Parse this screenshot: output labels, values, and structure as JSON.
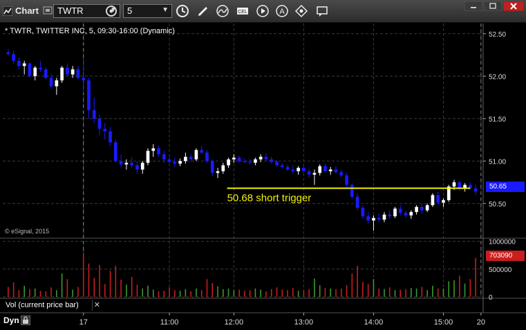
{
  "window": {
    "title": "Chart",
    "symbol_value": "TWTR",
    "interval_value": "5",
    "toolbar_icons": [
      "settings-icon",
      "clock-icon",
      "pencil-icon",
      "curve-icon",
      "study-icon",
      "play-icon",
      "text-icon",
      "tools-icon",
      "message-icon"
    ]
  },
  "chart": {
    "legend": "* TWTR, TWITTER INC, 5, 09:30-16:00 (Dynamic)",
    "copyright": "© eSignal, 2015",
    "last_price_label": "50.65",
    "last_volume_label": "703090",
    "annotation": "50.68 short trigger",
    "indicator_label": "Vol (current price bar)",
    "mode_label": "Dyn",
    "colors": {
      "up": "#ffffff",
      "down": "#1a1aff",
      "vol_up": "#3c9a2c",
      "vol_down": "#c81e1e",
      "trigger_line": "#f2f200",
      "price_tag": "#1a1aff",
      "vol_tag": "#c81e1e"
    }
  },
  "chart_data": {
    "type": "candlestick",
    "symbol": "TWTR",
    "price_axis": {
      "ticks": [
        "52.50",
        "52.00",
        "51.50",
        "51.00",
        "50.50"
      ],
      "ylim": [
        50.1,
        52.62
      ]
    },
    "volume_axis": {
      "ticks": [
        "1000000",
        "500000",
        "0"
      ],
      "ylim": [
        0,
        1020000
      ]
    },
    "time_axis": {
      "labels": [
        "17",
        "11:00",
        "12:00",
        "13:00",
        "14:00",
        "15:00",
        "20"
      ]
    },
    "trigger_level": 50.68,
    "ohlc": [
      [
        52.28,
        52.32,
        52.24,
        52.26
      ],
      [
        52.26,
        52.3,
        52.15,
        52.18
      ],
      [
        52.18,
        52.22,
        52.08,
        52.12
      ],
      [
        52.12,
        52.18,
        52.02,
        52.15
      ],
      [
        52.15,
        52.16,
        51.98,
        52.0
      ],
      [
        52.0,
        52.12,
        51.95,
        52.1
      ],
      [
        52.1,
        52.18,
        52.05,
        52.08
      ],
      [
        52.08,
        52.1,
        51.96,
        51.98
      ],
      [
        51.98,
        52.02,
        51.85,
        51.88
      ],
      [
        51.88,
        51.98,
        51.78,
        51.95
      ],
      [
        51.95,
        52.12,
        51.92,
        52.1
      ],
      [
        52.1,
        52.15,
        52.0,
        52.02
      ],
      [
        52.02,
        52.12,
        51.98,
        52.08
      ],
      [
        52.08,
        52.12,
        51.96,
        51.98
      ],
      [
        51.98,
        52.2,
        51.8,
        51.95
      ],
      [
        51.95,
        51.98,
        51.5,
        51.6
      ],
      [
        51.6,
        51.75,
        51.45,
        51.5
      ],
      [
        51.5,
        51.55,
        51.3,
        51.38
      ],
      [
        51.38,
        51.45,
        51.25,
        51.35
      ],
      [
        51.35,
        51.4,
        51.18,
        51.22
      ],
      [
        51.22,
        51.25,
        50.98,
        51.0
      ],
      [
        51.0,
        51.08,
        50.93,
        50.96
      ],
      [
        50.96,
        51.02,
        50.9,
        50.98
      ],
      [
        50.98,
        51.05,
        50.92,
        50.95
      ],
      [
        50.95,
        51.0,
        50.85,
        50.9
      ],
      [
        50.9,
        51.0,
        50.85,
        50.98
      ],
      [
        50.98,
        51.15,
        50.95,
        51.12
      ],
      [
        51.12,
        51.2,
        51.05,
        51.15
      ],
      [
        51.15,
        51.18,
        51.05,
        51.08
      ],
      [
        51.08,
        51.12,
        50.98,
        51.02
      ],
      [
        51.02,
        51.08,
        50.96,
        50.99
      ],
      [
        50.99,
        51.04,
        50.93,
        50.97
      ],
      [
        50.97,
        51.03,
        50.94,
        51.0
      ],
      [
        51.0,
        51.1,
        50.97,
        51.05
      ],
      [
        51.05,
        51.08,
        50.99,
        51.02
      ],
      [
        51.02,
        51.15,
        51.0,
        51.13
      ],
      [
        51.13,
        51.18,
        51.08,
        51.1
      ],
      [
        51.1,
        51.13,
        50.98,
        51.0
      ],
      [
        51.0,
        51.02,
        50.82,
        50.86
      ],
      [
        50.86,
        50.92,
        50.8,
        50.88
      ],
      [
        50.88,
        50.98,
        50.85,
        50.95
      ],
      [
        50.95,
        51.04,
        50.92,
        51.02
      ],
      [
        51.02,
        51.08,
        50.98,
        51.04
      ],
      [
        51.04,
        51.06,
        50.98,
        51.0
      ],
      [
        51.0,
        51.03,
        50.97,
        50.99
      ],
      [
        50.99,
        51.02,
        50.96,
        50.98
      ],
      [
        50.98,
        51.04,
        50.95,
        51.02
      ],
      [
        51.02,
        51.08,
        50.99,
        51.05
      ],
      [
        51.05,
        51.09,
        51.0,
        51.02
      ],
      [
        51.02,
        51.05,
        50.97,
        50.99
      ],
      [
        50.99,
        51.01,
        50.93,
        50.95
      ],
      [
        50.95,
        50.98,
        50.91,
        50.93
      ],
      [
        50.93,
        50.96,
        50.88,
        50.9
      ],
      [
        50.9,
        50.95,
        50.85,
        50.88
      ],
      [
        50.88,
        50.94,
        50.84,
        50.92
      ],
      [
        50.92,
        50.96,
        50.86,
        50.88
      ],
      [
        50.88,
        50.91,
        50.8,
        50.84
      ],
      [
        50.84,
        50.9,
        50.72,
        50.86
      ],
      [
        50.86,
        50.96,
        50.83,
        50.94
      ],
      [
        50.94,
        50.97,
        50.86,
        50.88
      ],
      [
        50.88,
        50.93,
        50.84,
        50.9
      ],
      [
        50.9,
        50.94,
        50.85,
        50.87
      ],
      [
        50.87,
        50.9,
        50.8,
        50.83
      ],
      [
        50.83,
        50.86,
        50.68,
        50.72
      ],
      [
        50.72,
        50.74,
        50.55,
        50.58
      ],
      [
        50.58,
        50.62,
        50.42,
        50.45
      ],
      [
        50.45,
        50.48,
        50.32,
        50.35
      ],
      [
        50.35,
        50.4,
        50.26,
        50.3
      ],
      [
        50.3,
        50.36,
        50.18,
        50.33
      ],
      [
        50.33,
        50.38,
        50.28,
        50.31
      ],
      [
        50.31,
        50.4,
        50.28,
        50.37
      ],
      [
        50.37,
        50.42,
        50.32,
        50.35
      ],
      [
        50.35,
        50.46,
        50.33,
        50.44
      ],
      [
        50.44,
        50.48,
        50.36,
        50.39
      ],
      [
        50.39,
        50.42,
        50.33,
        50.36
      ],
      [
        50.36,
        50.42,
        50.32,
        50.4
      ],
      [
        50.4,
        50.48,
        50.37,
        50.46
      ],
      [
        50.46,
        50.5,
        50.38,
        50.42
      ],
      [
        50.42,
        50.5,
        50.4,
        50.48
      ],
      [
        50.48,
        50.62,
        50.46,
        50.6
      ],
      [
        50.6,
        50.64,
        50.48,
        50.51
      ],
      [
        50.51,
        50.56,
        50.46,
        50.54
      ],
      [
        50.54,
        50.72,
        50.52,
        50.7
      ],
      [
        50.7,
        50.78,
        50.66,
        50.75
      ],
      [
        50.75,
        50.77,
        50.65,
        50.68
      ],
      [
        50.68,
        50.74,
        50.64,
        50.72
      ],
      [
        50.72,
        50.75,
        50.66,
        50.68
      ],
      [
        50.68,
        50.72,
        50.6,
        50.64
      ]
    ],
    "volume": [
      180000,
      260000,
      120000,
      200000,
      140000,
      150000,
      110000,
      100000,
      170000,
      120000,
      420000,
      320000,
      130000,
      180000,
      780000,
      600000,
      340000,
      570000,
      230000,
      470000,
      560000,
      310000,
      220000,
      360000,
      220000,
      150000,
      200000,
      130000,
      100000,
      110000,
      170000,
      120000,
      110000,
      140000,
      100000,
      150000,
      120000,
      320000,
      250000,
      190000,
      140000,
      150000,
      120000,
      130000,
      110000,
      120000,
      150000,
      130000,
      100000,
      140000,
      170000,
      130000,
      120000,
      160000,
      110000,
      120000,
      140000,
      330000,
      210000,
      160000,
      150000,
      140000,
      150000,
      210000,
      420000,
      560000,
      270000,
      230000,
      320000,
      150000,
      140000,
      170000,
      120000,
      130000,
      140000,
      160000,
      150000,
      180000,
      120000,
      200000,
      150000,
      150000,
      280000,
      300000,
      380000,
      240000,
      320000,
      703090
    ],
    "time_label_indices": [
      14,
      30,
      42,
      55,
      68,
      81,
      88
    ]
  }
}
